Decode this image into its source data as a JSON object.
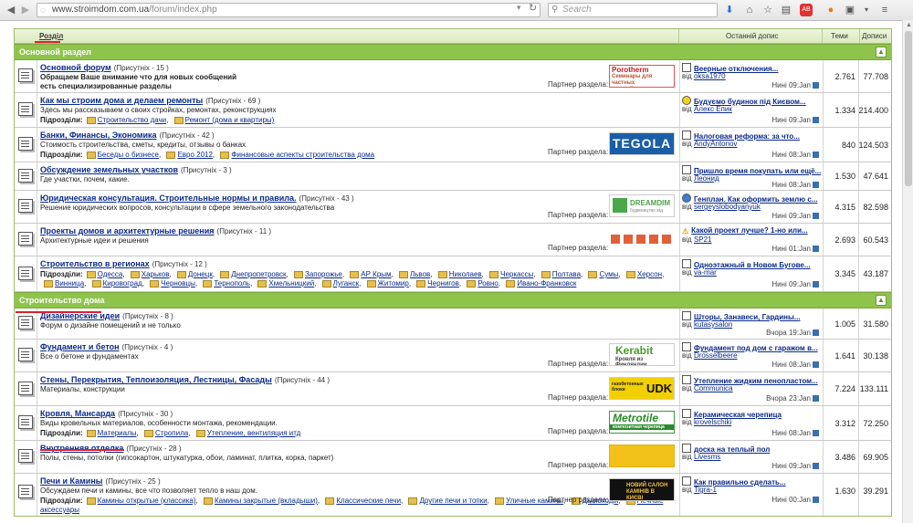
{
  "browser": {
    "url_domain": "www.stroimdom.com.ua",
    "url_path": "/forum/index.php",
    "search_placeholder": "Search"
  },
  "header": {
    "col_sections": "Розділ",
    "col_last_post": "Останній допис",
    "col_topics": "Теми",
    "col_posts": "Дописи"
  },
  "sections": [
    {
      "title": "Основной раздел",
      "forums": [
        {
          "name": "Основной форум",
          "present": "(Присутніх - 15 )",
          "desc": "Обращаем Ваше внимание что для новых сообщений есть специализированные разделы",
          "subs": [],
          "partner": "Партнер раздела:",
          "ad": "Porotherm",
          "ad2": "Семинары для частных застройщиков",
          "last_title": "Веерные отключения...",
          "last_by": "від",
          "last_user": "oksa1970",
          "last_date": "Нині 09:Jan",
          "topics": "2.761",
          "posts": "77.708"
        },
        {
          "name": "Как мы строим дома и делаем ремонты",
          "present": "(Присутніх - 69 )",
          "desc": "Здесь мы рассказываем о своих стройках, ремонтах, реконструкциях",
          "subs": [
            "Строительство дачи",
            "Ремонт (дома и квартиры)"
          ],
          "last_title": "Будуємо будинок під Києвом...",
          "last_by": "від",
          "last_user": "Алекс Епик",
          "last_date": "Нині 09:Jan",
          "topics": "1.334",
          "posts": "214.400"
        },
        {
          "name": "Банки, Финансы, Экономика",
          "present": "(Присутніх - 42 )",
          "desc": "Стоимость строительства, сметы, кредиты, отзывы о банках",
          "subs": [
            "Беседы о бизнесе",
            "Евро 2012",
            "Финансовые аспекты строительства дома"
          ],
          "partner": "Партнер раздела:",
          "ad": "TEGOLA",
          "last_title": "Налоговая реформа: за что...",
          "last_by": "від",
          "last_user": "AndyAntonov",
          "last_date": "Нині 08:Jan",
          "topics": "840",
          "posts": "124.503"
        },
        {
          "name": "Обсуждение земельных участков",
          "present": "(Присутніх - 3 )",
          "desc": "Где участки, почем, какие.",
          "subs": [],
          "last_title": "Пришло время покупать или ещё...",
          "last_by": "від",
          "last_user": "Леонид",
          "last_date": "Нині 08:Jan",
          "topics": "1.530",
          "posts": "47.641"
        },
        {
          "name": "Юридическая консультация. Строительные нормы и правила.",
          "present": "(Присутніх - 43 )",
          "desc": "Решение юридических вопросов, консультации в сфере земельного законодательства",
          "subs": [],
          "partner": "Партнер раздела:",
          "ad": "DREAMDIM",
          "ad2": "будівництво від",
          "last_title": "Генплан. Как оформить землю с...",
          "last_by": "від",
          "last_user": "sergeyslobodyanyuk",
          "last_date": "Нині 09:Jan",
          "topics": "4.315",
          "posts": "82.598"
        },
        {
          "name": "Проекты домов и архитектурные решения",
          "present": "(Присутніх - 11 )",
          "desc": "Архитектурные идеи и решения",
          "subs": [],
          "partner": "Партнер раздела:",
          "ad": "",
          "last_title": "Какой проект лучше? 1-но или...",
          "last_by": "від",
          "last_user": "SP21",
          "last_date": "Нині 01:Jan",
          "topics": "2.693",
          "posts": "60.543"
        },
        {
          "name": "Строительство в регионах",
          "present": "(Присутніх - 12 )",
          "desc": "",
          "subs": [
            "Одесса",
            "Харьков",
            "Донецк",
            "Днепропетровск",
            "Запорожье",
            "АР Крым",
            "Львов",
            "Николаев",
            "Черкассы",
            "Полтава",
            "Сумы",
            "Херсон",
            "Винница",
            "Кировоград",
            "Черновцы",
            "Тернополь",
            "Хмельницкий",
            "Луганск",
            "Житомир",
            "Чернигов",
            "Ровно",
            "Ивано-Франковск"
          ],
          "last_title": "Одноэтажный в Новом Бугове...",
          "last_by": "від",
          "last_user": "va-mar",
          "last_date": "Нині 09:Jan",
          "topics": "3.345",
          "posts": "43.187"
        }
      ]
    },
    {
      "title": "Строительство дома",
      "forums": [
        {
          "name": "Дизайнерские идеи",
          "present": "(Присутніх - 8 )",
          "desc": "Форум о дизайне помещений и не только",
          "subs": [],
          "last_title": "Шторы, Занавеси, Гардины...",
          "last_by": "від",
          "last_user": "kutasysalon",
          "last_date": "Вчора 19:Jan",
          "topics": "1.005",
          "posts": "31.580"
        },
        {
          "name": "Фундамент и бетон",
          "present": "(Присутніх - 4 )",
          "desc": "Все о бетоне и фундаментах",
          "subs": [],
          "partner": "Партнер раздела:",
          "ad": "Kerabit",
          "ad2": "Кровля из Финляндии",
          "last_title": "Фундамент под дом с гаражом в...",
          "last_by": "від",
          "last_user": "Drosselbeere",
          "last_date": "Нині 08:Jan",
          "topics": "1.641",
          "posts": "30.138"
        },
        {
          "name": "Стены, Перекрытия, Теплоизоляция, Лестницы, Фасады",
          "present": "(Присутніх - 44 )",
          "desc": "Материалы, конструкции",
          "subs": [],
          "partner": "Партнер раздела:",
          "ad": "UDK",
          "ad2": "газобетонные блоки",
          "last_title": "Утепление жидким пенопластом...",
          "last_by": "від",
          "last_user": "Communica",
          "last_date": "Вчора 23:Jan",
          "topics": "7.224",
          "posts": "133.111"
        },
        {
          "name": "Кровля, Мансарда",
          "present": "(Присутніх - 30 )",
          "desc": "Виды кровельных материалов, особенности монтажа, рекомендации.",
          "subs": [
            "Материалы",
            "Стропила",
            "Утепление, вентиляция итд"
          ],
          "partner": "Партнер раздела:",
          "ad": "Metrotile",
          "ad2": "композитная черепица",
          "last_title": "Керамическая черепица",
          "last_by": "від",
          "last_user": "krovelschiki",
          "last_date": "Нині 08:Jan",
          "topics": "3.312",
          "posts": "72.250"
        },
        {
          "name": "Внутренняя отделка",
          "present": "(Присутніх - 28 )",
          "desc": "Полы, стены, потолки (гипсокартон, штукатурка, обои, ламинат, плитка, корка, паркет)",
          "subs": [],
          "partner": "Партнер раздела:",
          "ad": "",
          "last_title": "доска на теплый пол",
          "last_by": "від",
          "last_user": "Livesms",
          "last_date": "Нині 09:Jan",
          "topics": "3.486",
          "posts": "69.905"
        },
        {
          "name": "Печи и Камины",
          "present": "(Присутніх - 25 )",
          "desc": "Обсуждаем печи и камины, все что позволяет тепло в наш дом.",
          "subs": [
            "Камины открытые (классика)",
            "Камины закрытые (вкладыши)",
            "Классические печи",
            "Другие печи и топки",
            "Уличные камины",
            "Дымоходы",
            "Печные аксессуары"
          ],
          "partner": "Партнер раздела:",
          "ad": "НОВИЙ САЛОН КАМІНІВ В КИЄВІ",
          "last_title": "Как правильно сделать...",
          "last_by": "від",
          "last_user": "Tigra-1",
          "last_date": "Нині 00:Jan",
          "topics": "1.630",
          "posts": "39.291"
        }
      ]
    }
  ],
  "labels": {
    "subforums": "Підрозділи:"
  },
  "colors": {
    "section_bg": "#8fc44c",
    "link": "#0a2a8a",
    "header_bg": "#dbe9c0",
    "red_underline": "#e0202c"
  }
}
